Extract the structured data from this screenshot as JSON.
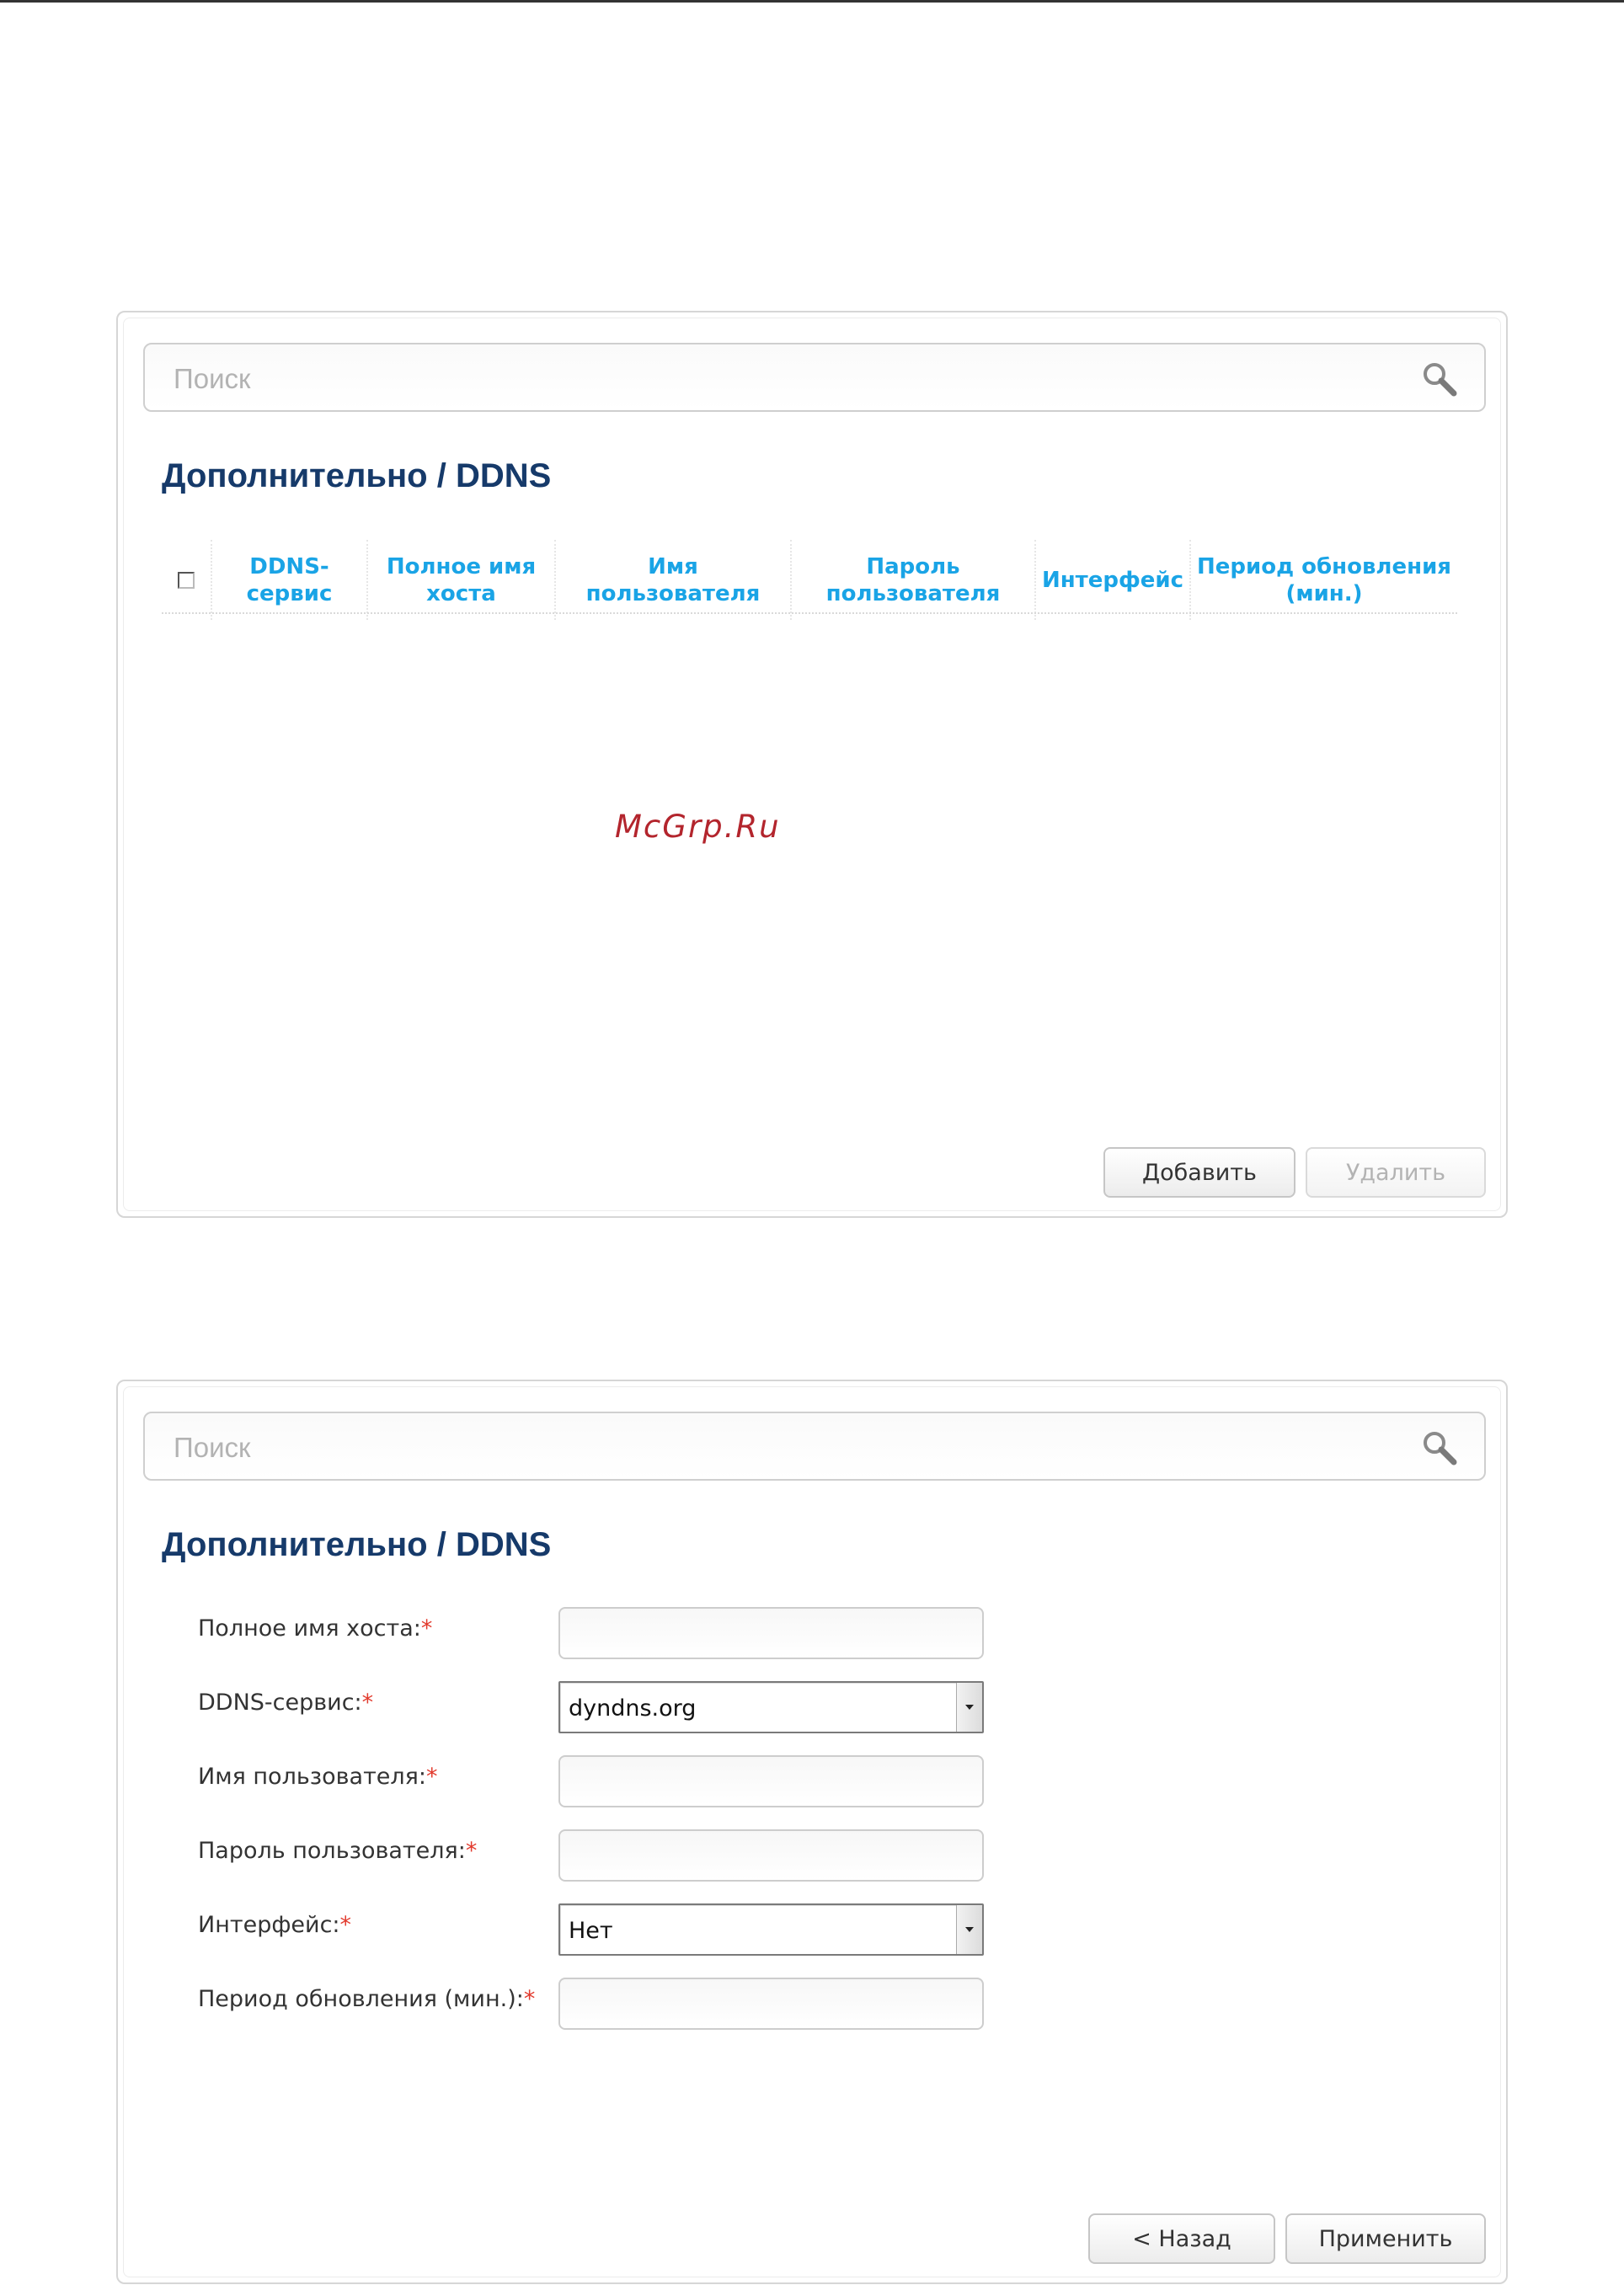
{
  "screen1": {
    "search_placeholder": "Поиск",
    "title": "Дополнительно /  DDNS",
    "columns": [
      {
        "label": "DDNS-\nсервис"
      },
      {
        "label": "Полное имя\nхоста"
      },
      {
        "label": "Имя\nпользователя"
      },
      {
        "label": "Пароль\nпользователя"
      },
      {
        "label": "Интерфейс"
      },
      {
        "label": "Период обновления\n(мин.)"
      }
    ],
    "add_label": "Добавить",
    "delete_label": "Удалить"
  },
  "watermark": "McGrp.Ru",
  "screen2": {
    "search_placeholder": "Поиск",
    "title": "Дополнительно /  DDNS",
    "fields": [
      {
        "label": "Полное имя хоста:",
        "required": "*",
        "type": "text",
        "value": ""
      },
      {
        "label": "DDNS-сервис:",
        "required": "*",
        "type": "select",
        "value": "dyndns.org"
      },
      {
        "label": "Имя пользователя:",
        "required": "*",
        "type": "text",
        "value": ""
      },
      {
        "label": "Пароль пользователя:",
        "required": "*",
        "type": "text",
        "value": ""
      },
      {
        "label": "Интерфейс:",
        "required": "*",
        "type": "select",
        "value": "Нет"
      },
      {
        "label": "Период обновления (мин.):",
        "required": "*",
        "type": "text",
        "value": ""
      }
    ],
    "back_label": "< Назад",
    "apply_label": "Применить"
  },
  "colors": {
    "title": "#163a6a",
    "column_header": "#1aa4e6",
    "required_mark": "#e23b2e",
    "watermark": "#b3252d"
  },
  "icons": {
    "search": "magnifier-icon",
    "select_arrow": "triangle-down-icon"
  }
}
